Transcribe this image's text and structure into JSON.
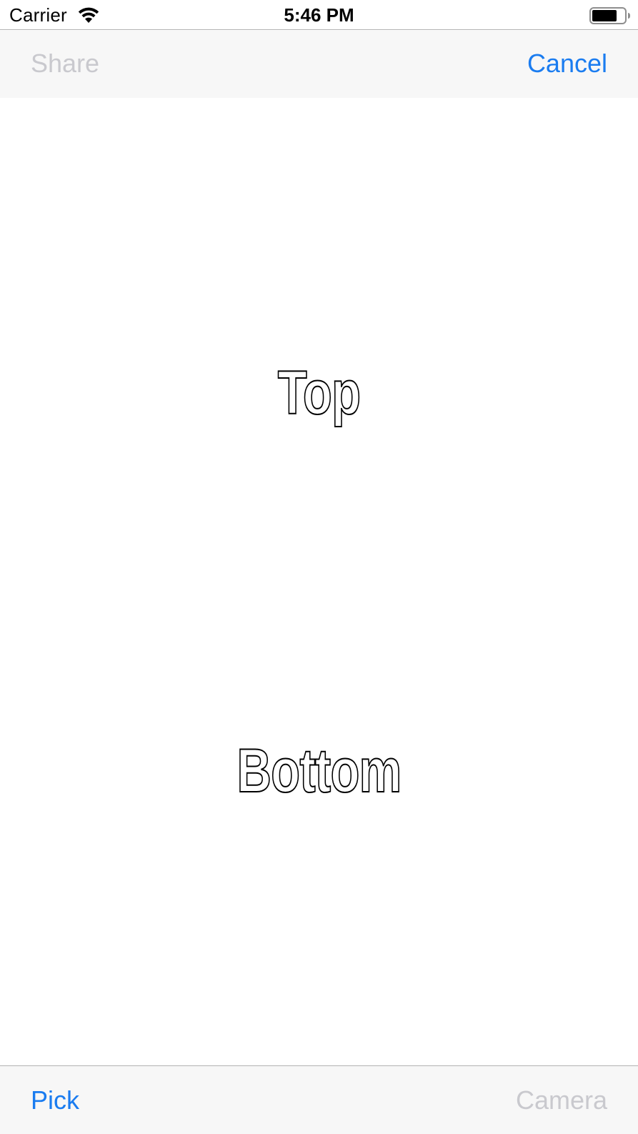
{
  "status_bar": {
    "carrier": "Carrier",
    "time": "5:46 PM",
    "wifi_icon": "wifi-icon",
    "battery_icon": "battery-icon"
  },
  "nav_bar": {
    "share_label": "Share",
    "cancel_label": "Cancel"
  },
  "meme": {
    "top_text": "Top",
    "bottom_text": "Bottom"
  },
  "toolbar": {
    "pick_label": "Pick",
    "camera_label": "Camera"
  },
  "colors": {
    "accent": "#1a7cf0",
    "disabled": "#c9c9ce",
    "bar_background": "#f7f7f7"
  }
}
